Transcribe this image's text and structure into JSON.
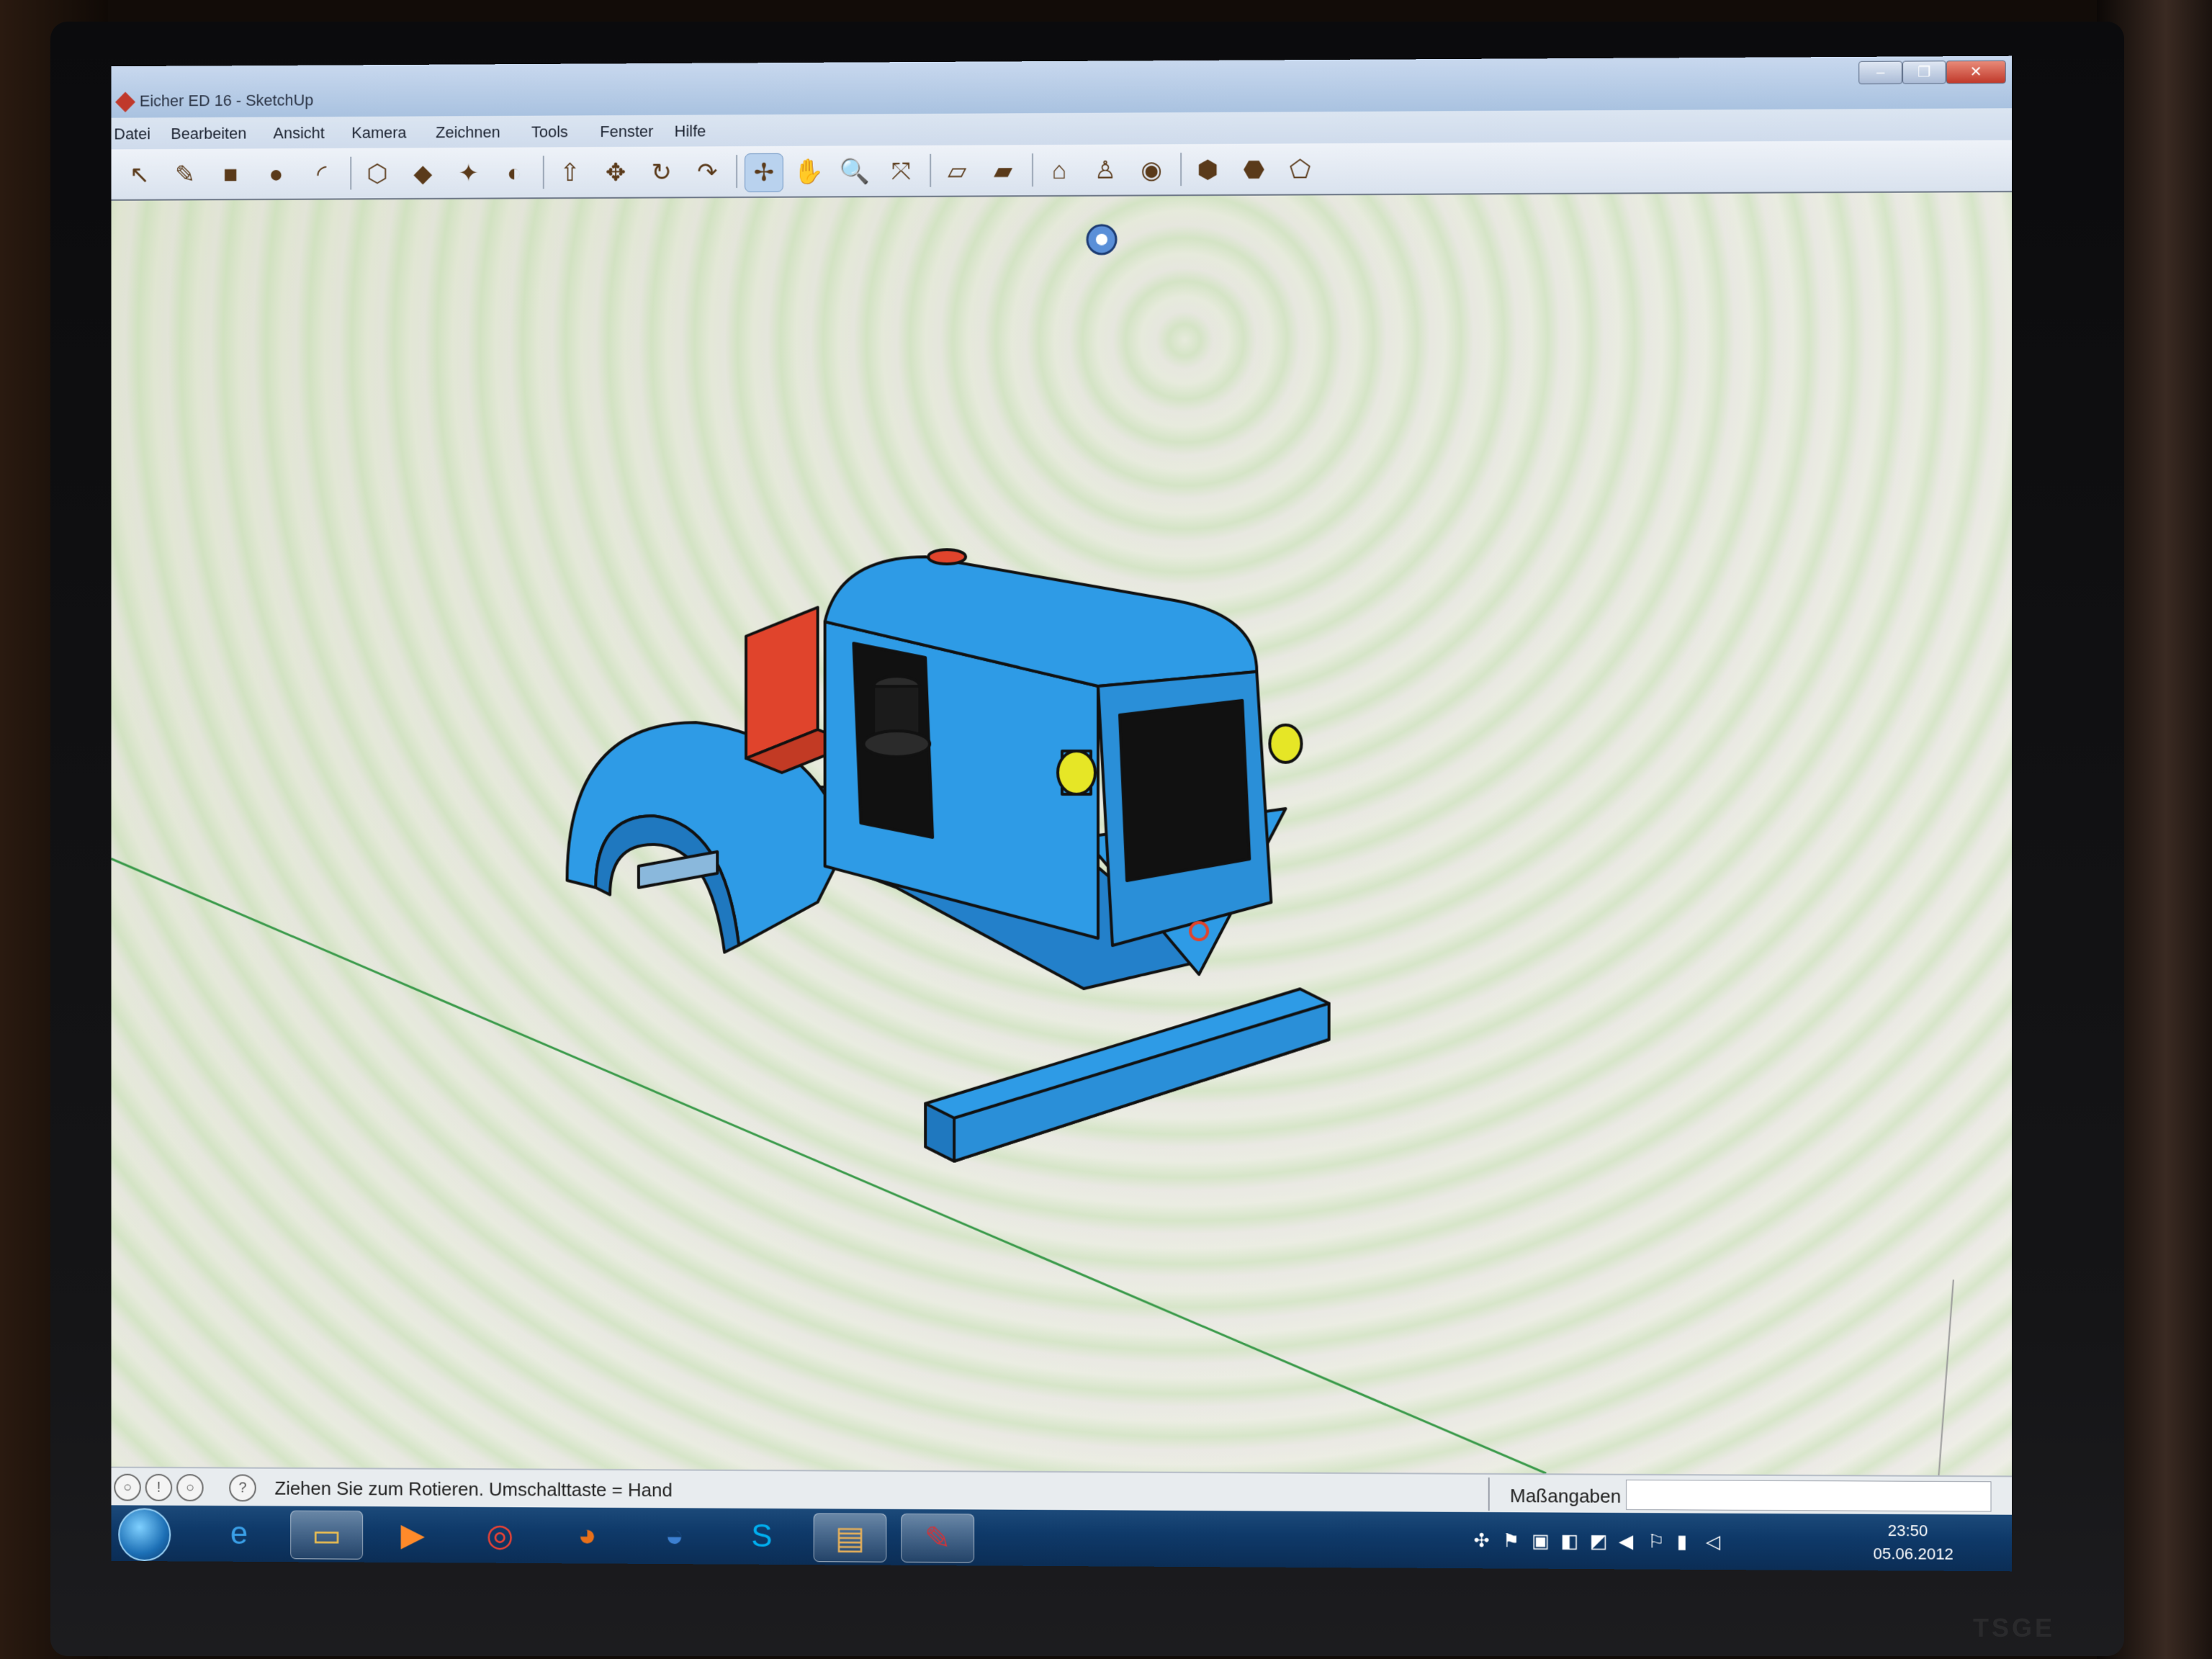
{
  "window": {
    "title": "Eicher ED 16 - SketchUp",
    "buttons": {
      "minimize": "–",
      "maximize": "❐",
      "close": "✕"
    }
  },
  "menu": [
    "Datei",
    "Bearbeiten",
    "Ansicht",
    "Kamera",
    "Zeichnen",
    "Tools",
    "Fenster",
    "Hilfe"
  ],
  "toolbar": [
    {
      "name": "select-icon",
      "glyph": "↖"
    },
    {
      "name": "pencil-icon",
      "glyph": "✎"
    },
    {
      "name": "rectangle-icon",
      "glyph": "■"
    },
    {
      "name": "circle-icon",
      "glyph": "●"
    },
    {
      "name": "arc-icon",
      "glyph": "◜"
    },
    {
      "name": "eraser-icon",
      "glyph": "⬡"
    },
    {
      "name": "paint-bucket-icon",
      "glyph": "◆"
    },
    {
      "name": "tape-measure-icon",
      "glyph": "✦"
    },
    {
      "name": "protractor-icon",
      "glyph": "◐"
    },
    {
      "name": "push-pull-icon",
      "glyph": "⇧"
    },
    {
      "name": "move-icon",
      "glyph": "✥"
    },
    {
      "name": "rotate-icon",
      "glyph": "↻"
    },
    {
      "name": "follow-me-icon",
      "glyph": "↷"
    },
    {
      "name": "orbit-icon",
      "glyph": "✢",
      "active": true
    },
    {
      "name": "pan-icon",
      "glyph": "✋"
    },
    {
      "name": "zoom-icon",
      "glyph": "🔍"
    },
    {
      "name": "zoom-extents-icon",
      "glyph": "⤧"
    },
    {
      "name": "section-plane-icon",
      "glyph": "▱"
    },
    {
      "name": "section-display-icon",
      "glyph": "▰"
    },
    {
      "name": "warehouse-icon",
      "glyph": "⌂"
    },
    {
      "name": "position-camera-icon",
      "glyph": "♙"
    },
    {
      "name": "look-around-icon",
      "glyph": "◉"
    },
    {
      "name": "share-model-icon",
      "glyph": "⬢"
    },
    {
      "name": "get-models-icon",
      "glyph": "⬣"
    },
    {
      "name": "components-icon",
      "glyph": "⬠"
    }
  ],
  "status": {
    "hint": "Ziehen Sie zum Rotieren.  Umschalttaste = Hand",
    "measure_label": "Maßangaben",
    "measure_value": ""
  },
  "taskbar": {
    "apps": [
      {
        "name": "internet-explorer-icon",
        "glyph": "e",
        "color": "#3aa0e8"
      },
      {
        "name": "explorer-folder-icon",
        "glyph": "▭",
        "color": "#f0c050"
      },
      {
        "name": "media-player-icon",
        "glyph": "▶",
        "color": "#ff8a2a"
      },
      {
        "name": "chrome-icon",
        "glyph": "◎",
        "color": "#e94235"
      },
      {
        "name": "firefox-icon",
        "glyph": "◕",
        "color": "#e8701a"
      },
      {
        "name": "google-earth-icon",
        "glyph": "◒",
        "color": "#3c7fd0"
      },
      {
        "name": "skype-icon",
        "glyph": "S",
        "color": "#00aff0"
      },
      {
        "name": "archive-icon",
        "glyph": "▤",
        "color": "#e6b05a"
      },
      {
        "name": "sketchup-icon",
        "glyph": "✎",
        "color": "#c9363e"
      }
    ],
    "clock_time": "23:50",
    "clock_date": "05.06.2012"
  },
  "bezel": {
    "logo": "TSGE"
  },
  "colors": {
    "model_blue": "#2e9be6",
    "model_blue_dark": "#1f78bf",
    "seat_red": "#e0442c",
    "engine_black": "#111111",
    "lamp_yellow": "#e6e626"
  }
}
